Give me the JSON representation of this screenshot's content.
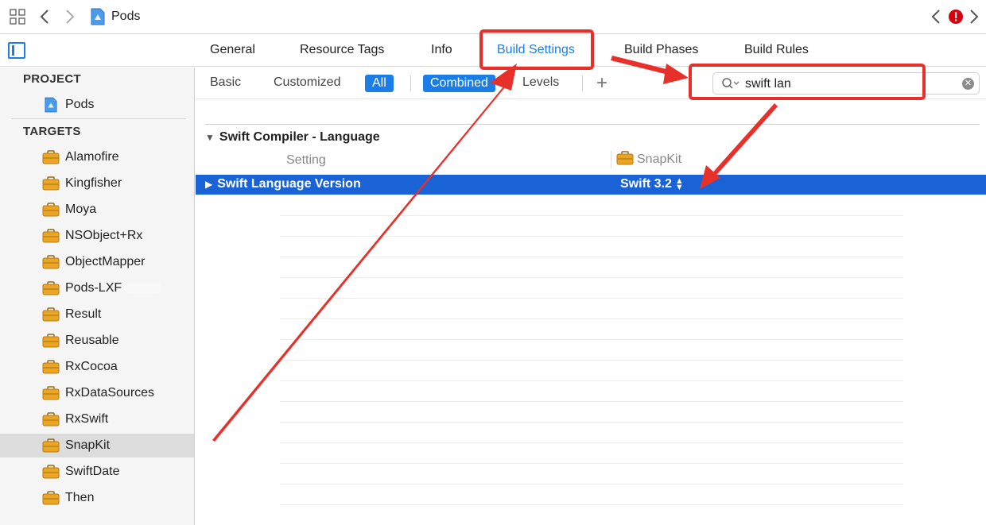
{
  "toolbar": {
    "breadcrumb": "Pods",
    "icons": [
      "grid-icon",
      "back-arrow-icon",
      "forward-arrow-icon",
      "project-file-icon",
      "issue-back-icon",
      "error-badge-icon",
      "issue-forward-icon"
    ]
  },
  "tabs": [
    {
      "label": "General",
      "active": false
    },
    {
      "label": "Resource Tags",
      "active": false
    },
    {
      "label": "Info",
      "active": false
    },
    {
      "label": "Build Settings",
      "active": true
    },
    {
      "label": "Build Phases",
      "active": false
    },
    {
      "label": "Build Rules",
      "active": false
    }
  ],
  "sidebar": {
    "project_header": "PROJECT",
    "project_item": "Pods",
    "targets_header": "TARGETS",
    "targets": [
      {
        "label": "Alamofire",
        "selected": false
      },
      {
        "label": "Kingfisher",
        "selected": false
      },
      {
        "label": "Moya",
        "selected": false
      },
      {
        "label": "NSObject+Rx",
        "selected": false
      },
      {
        "label": "ObjectMapper",
        "selected": false
      },
      {
        "label": "Pods-LXF",
        "selected": false
      },
      {
        "label": "Result",
        "selected": false
      },
      {
        "label": "Reusable",
        "selected": false
      },
      {
        "label": "RxCocoa",
        "selected": false
      },
      {
        "label": "RxDataSources",
        "selected": false
      },
      {
        "label": "RxSwift",
        "selected": false
      },
      {
        "label": "SnapKit",
        "selected": true
      },
      {
        "label": "SwiftDate",
        "selected": false
      },
      {
        "label": "Then",
        "selected": false
      }
    ]
  },
  "filter": {
    "basic": "Basic",
    "customized": "Customized",
    "all": "All",
    "combined": "Combined",
    "levels": "Levels",
    "add": "+",
    "search_value": "swift lan"
  },
  "settings": {
    "section_title": "Swift Compiler - Language",
    "col_setting": "Setting",
    "col_target": "SnapKit",
    "row_name": "Swift Language Version",
    "row_value": "Swift 3.2"
  },
  "colors": {
    "accent": "#1a7ee6",
    "selected_row": "#1a63d6",
    "annotation": "#e8302a",
    "error_badge": "#d9000d",
    "toolbox_icon": "#e9a626"
  }
}
